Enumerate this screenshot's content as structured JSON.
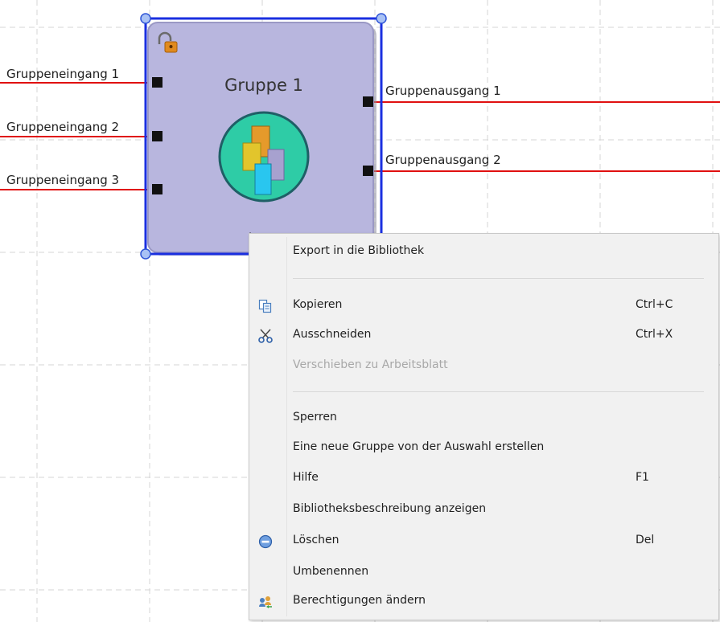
{
  "canvas": {
    "group": {
      "title": "Gruppe 1",
      "icon": "group-icon",
      "lock_icon": "unlocked-padlock-icon",
      "selection_color": "#1a2fe0",
      "fill_color": "#b8b6de"
    },
    "inputs": [
      "Gruppeneingang 1",
      "Gruppeneingang 2",
      "Gruppeneingang 3"
    ],
    "outputs": [
      "Gruppenausgang 1",
      "Gruppenausgang 2"
    ],
    "wire_color": "#e01010"
  },
  "context_menu": {
    "items": [
      {
        "label": "Export in die Bibliothek",
        "shortcut": "",
        "icon": "",
        "enabled": true
      },
      {
        "label": "Kopieren",
        "shortcut": "Ctrl+C",
        "icon": "copy-icon",
        "enabled": true
      },
      {
        "label": "Ausschneiden",
        "shortcut": "Ctrl+X",
        "icon": "scissors-icon",
        "enabled": true
      },
      {
        "label": "Verschieben zu Arbeitsblatt",
        "shortcut": "",
        "icon": "",
        "enabled": false
      },
      {
        "label": "Sperren",
        "shortcut": "",
        "icon": "",
        "enabled": true
      },
      {
        "label": "Eine neue Gruppe von der Auswahl erstellen",
        "shortcut": "",
        "icon": "",
        "enabled": true
      },
      {
        "label": "Hilfe",
        "shortcut": "F1",
        "icon": "",
        "enabled": true
      },
      {
        "label": "Bibliotheksbeschreibung anzeigen",
        "shortcut": "",
        "icon": "",
        "enabled": true
      },
      {
        "label": "Löschen",
        "shortcut": "Del",
        "icon": "delete-icon",
        "enabled": true
      },
      {
        "label": "Umbenennen",
        "shortcut": "",
        "icon": "",
        "enabled": true
      },
      {
        "label": "Berechtigungen ändern",
        "shortcut": "",
        "icon": "permissions-icon",
        "enabled": true
      }
    ]
  }
}
